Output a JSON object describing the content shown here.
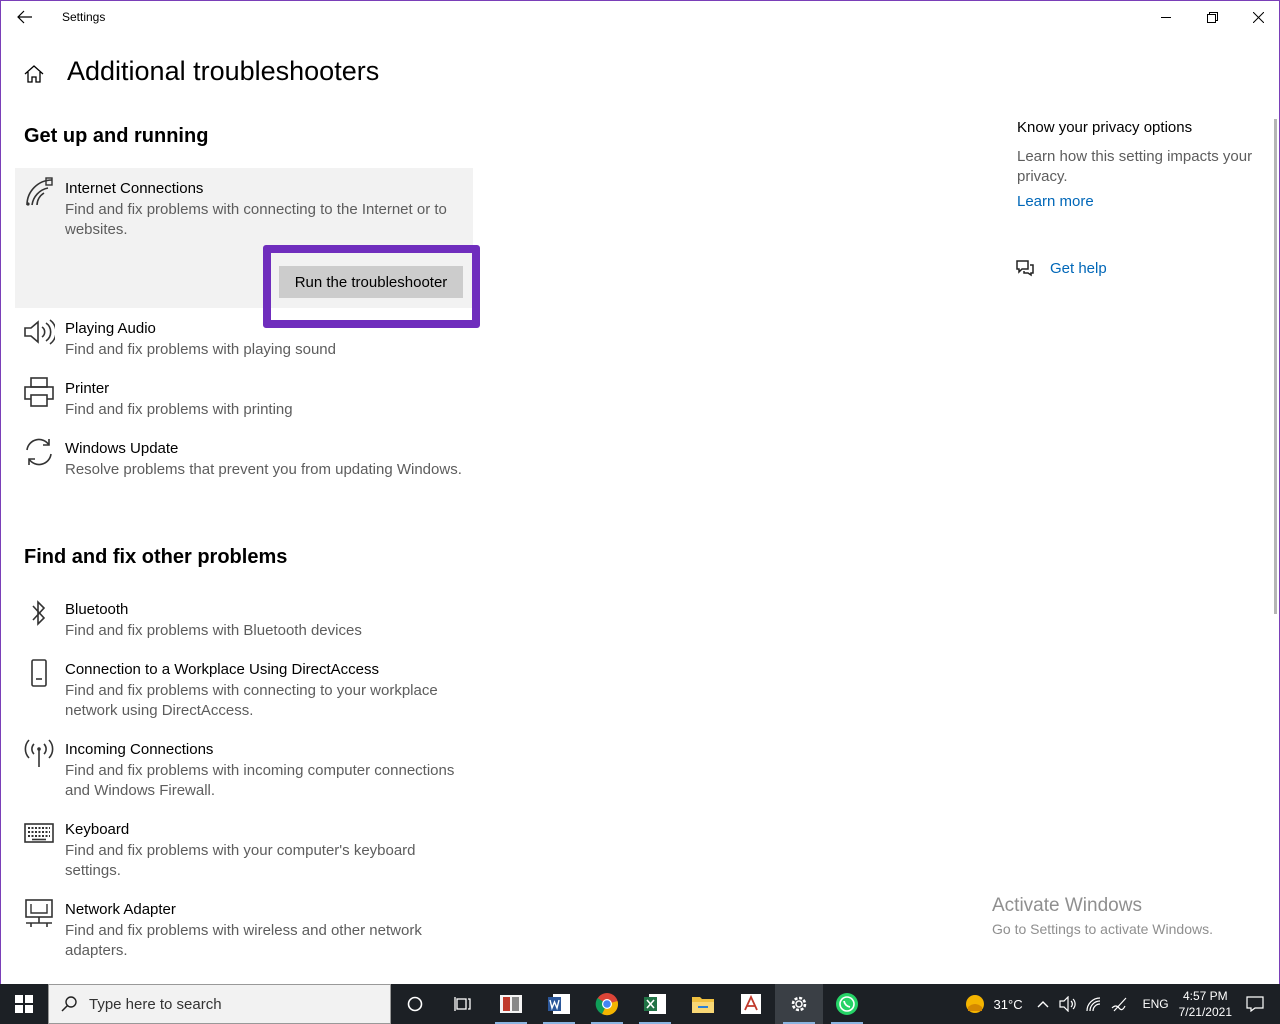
{
  "window": {
    "title": "Settings"
  },
  "page": {
    "title": "Additional troubleshooters"
  },
  "sections": [
    {
      "title": "Get up and running"
    },
    {
      "title": "Find and fix other problems"
    }
  ],
  "troubleshooters": [
    {
      "name": "Internet Connections",
      "desc": "Find and fix problems with connecting to the Internet or to websites.",
      "icon": "wifi-icon",
      "selected": true
    },
    {
      "name": "Playing Audio",
      "desc": "Find and fix problems with playing sound",
      "icon": "speaker-icon"
    },
    {
      "name": "Printer",
      "desc": "Find and fix problems with printing",
      "icon": "printer-icon"
    },
    {
      "name": "Windows Update",
      "desc": "Resolve problems that prevent you from updating Windows.",
      "icon": "refresh-icon"
    }
  ],
  "other_troubleshooters": [
    {
      "name": "Bluetooth",
      "desc": "Find and fix problems with Bluetooth devices",
      "icon": "bluetooth-icon"
    },
    {
      "name": "Connection to a Workplace Using DirectAccess",
      "desc": "Find and fix problems with connecting to your workplace network using DirectAccess.",
      "icon": "phone-icon"
    },
    {
      "name": "Incoming Connections",
      "desc": "Find and fix problems with incoming computer connections and Windows Firewall.",
      "icon": "antenna-icon"
    },
    {
      "name": "Keyboard",
      "desc": "Find and fix problems with your computer's keyboard settings.",
      "icon": "keyboard-icon"
    },
    {
      "name": "Network Adapter",
      "desc": "Find and fix problems with wireless and other network adapters.",
      "icon": "network-adapter-icon"
    }
  ],
  "run_button_label": "Run the troubleshooter",
  "side": {
    "privacy_title": "Know your privacy options",
    "privacy_desc": "Learn how this setting impacts your privacy.",
    "learn_more": "Learn more",
    "get_help": "Get help"
  },
  "watermark": {
    "line1": "Activate Windows",
    "line2": "Go to Settings to activate Windows."
  },
  "taskbar": {
    "search_placeholder": "Type here to search",
    "temperature": "31°C",
    "language": "ENG",
    "time": "4:57 PM",
    "date": "7/21/2021"
  },
  "colors": {
    "accent": "#0067b8",
    "highlight": "#6f2dbd"
  }
}
